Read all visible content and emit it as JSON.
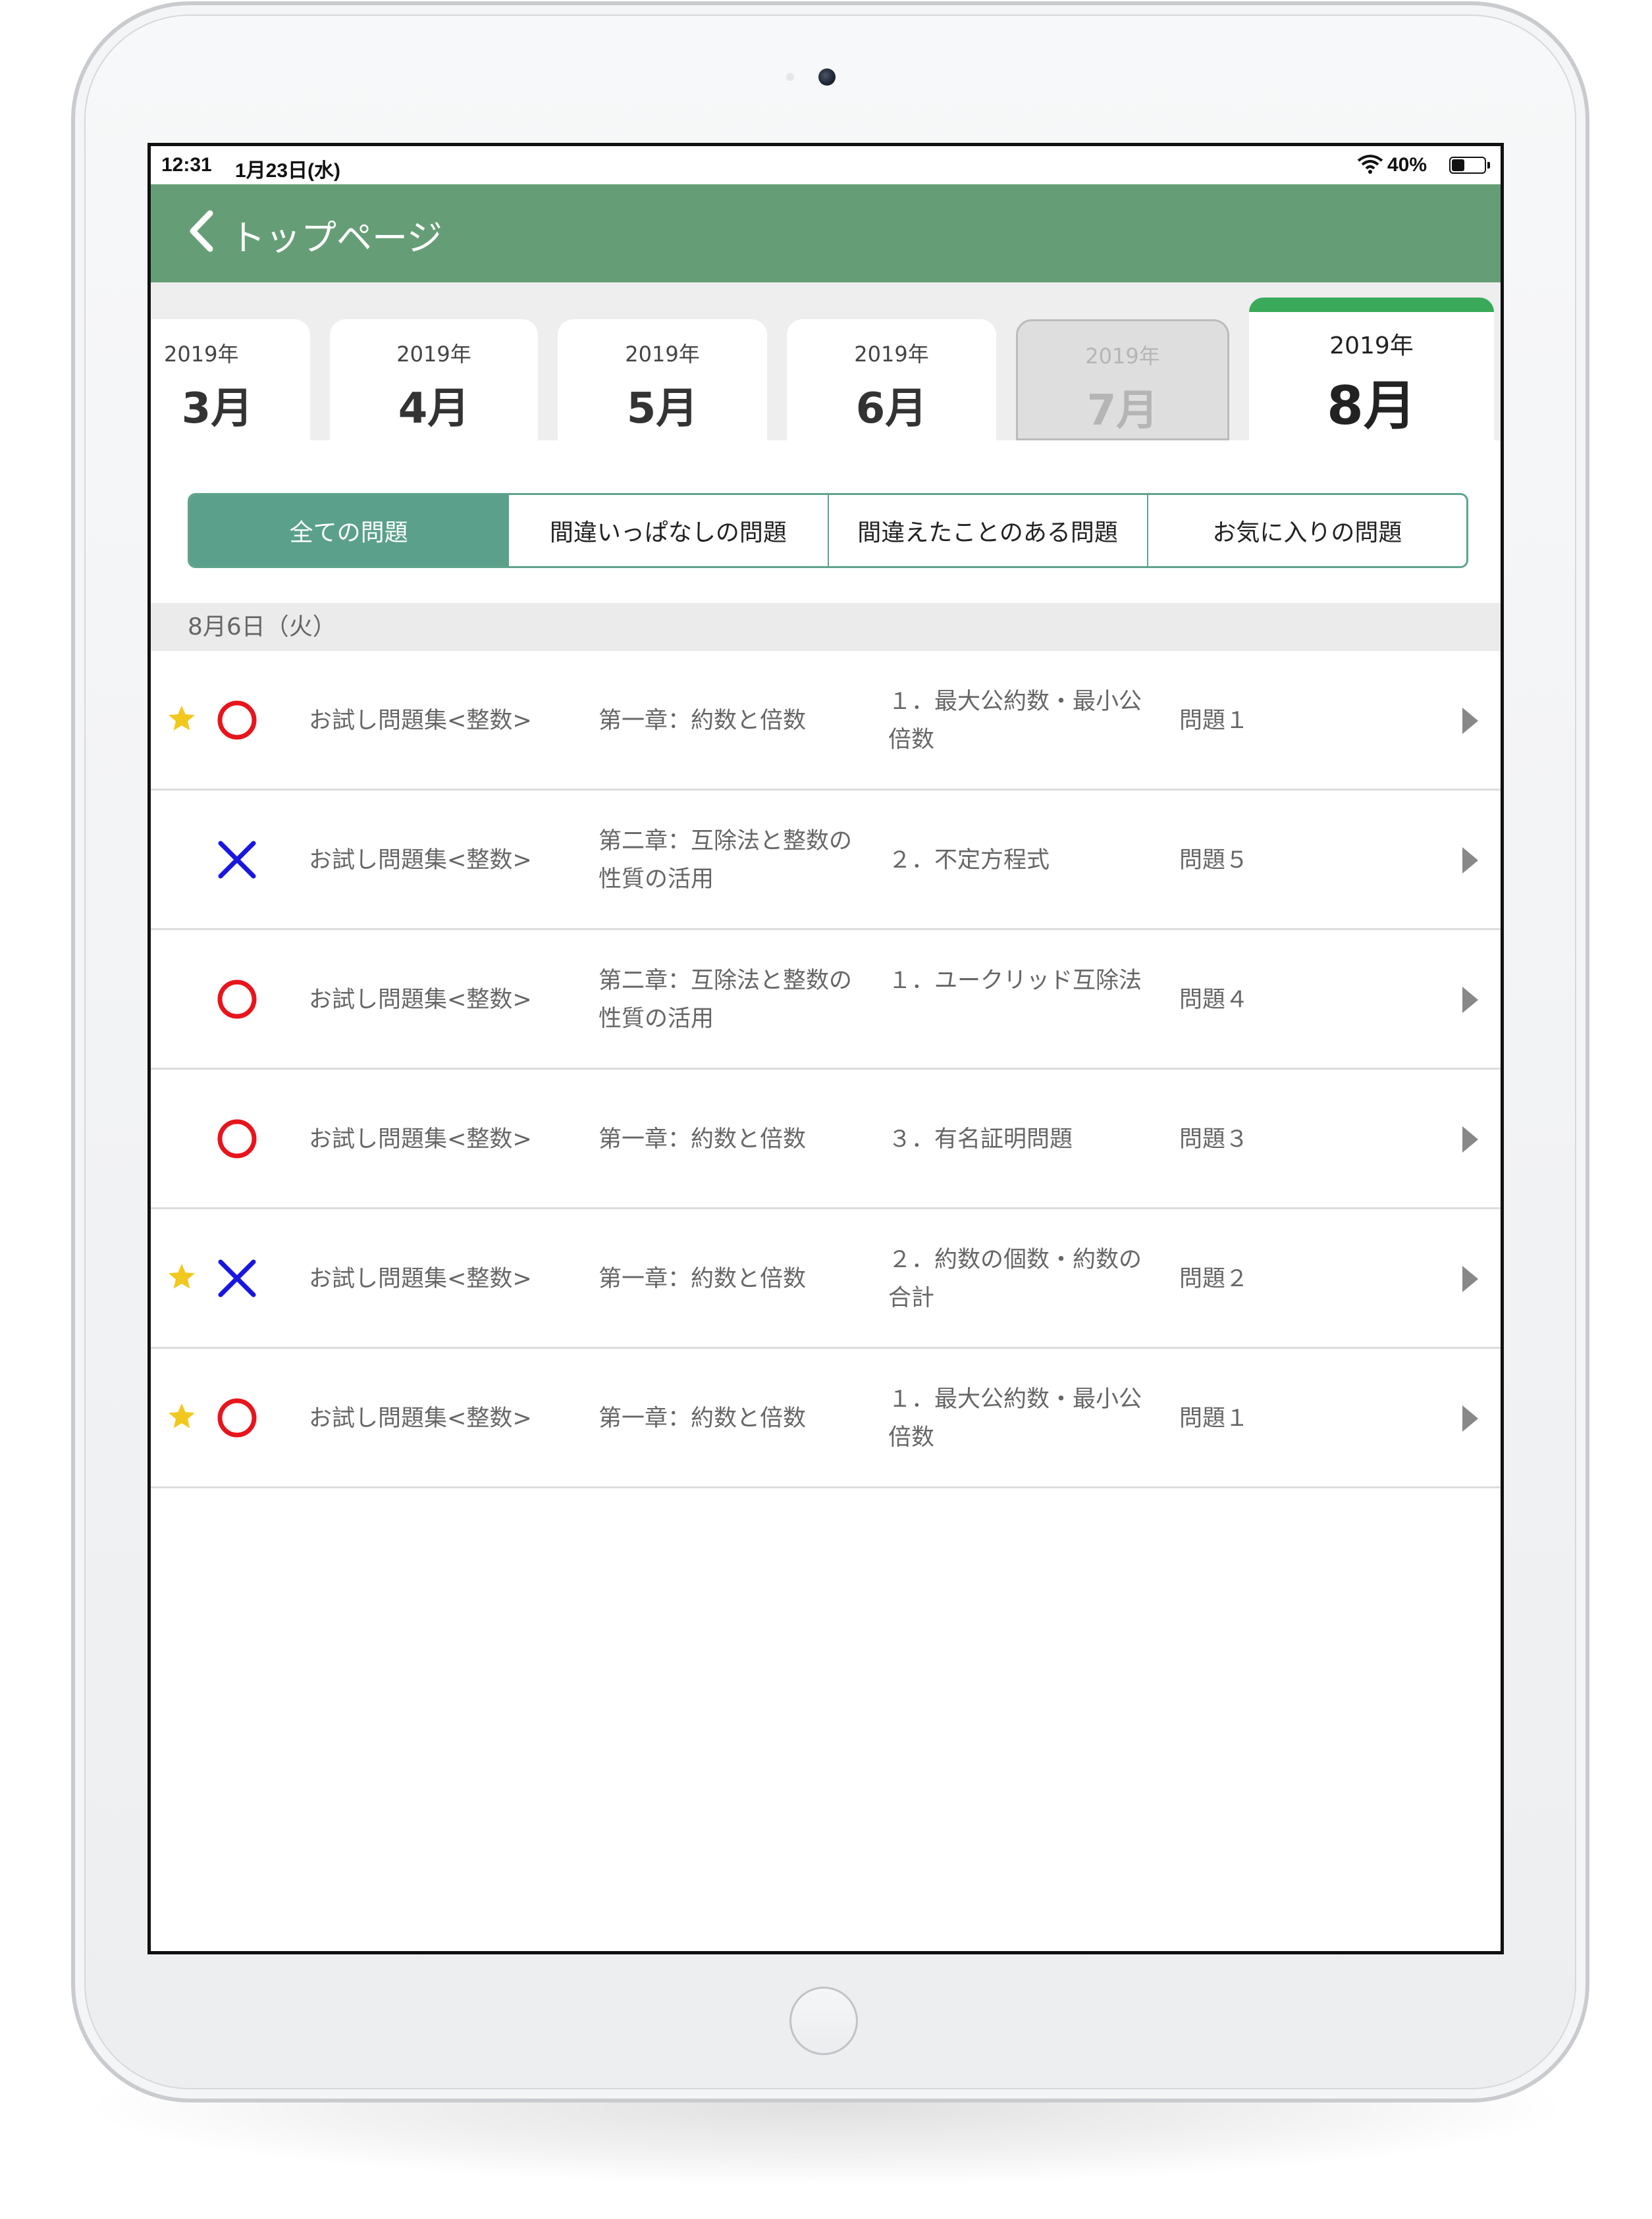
{
  "status_bar": {
    "time": "12:31",
    "date": "1月23日(水)",
    "battery": "40%"
  },
  "nav": {
    "back_label": "トップページ"
  },
  "months": [
    {
      "year": "2019年",
      "month": "3月",
      "state": "normal"
    },
    {
      "year": "2019年",
      "month": "4月",
      "state": "normal"
    },
    {
      "year": "2019年",
      "month": "5月",
      "state": "normal"
    },
    {
      "year": "2019年",
      "month": "6月",
      "state": "normal"
    },
    {
      "year": "2019年",
      "month": "7月",
      "state": "disabled"
    },
    {
      "year": "2019年",
      "month": "8月",
      "state": "active"
    }
  ],
  "filters": [
    {
      "label": "全ての問題",
      "active": true
    },
    {
      "label": "間違いっぱなしの問題",
      "active": false
    },
    {
      "label": "間違えたことのある問題",
      "active": false
    },
    {
      "label": "お気に入りの問題",
      "active": false
    }
  ],
  "section": {
    "date": "8月6日（火）"
  },
  "rows": [
    {
      "favorite": true,
      "result": "correct",
      "collection": "お試し問題集<整数>",
      "chapter": "第一章：約数と倍数",
      "section": "１．最大公約数・最小公倍数",
      "problem": "問題１"
    },
    {
      "favorite": false,
      "result": "incorrect",
      "collection": "お試し問題集<整数>",
      "chapter": "第二章：互除法と整数の性質の活用",
      "section": "２．不定方程式",
      "problem": "問題５"
    },
    {
      "favorite": false,
      "result": "correct",
      "collection": "お試し問題集<整数>",
      "chapter": "第二章：互除法と整数の性質の活用",
      "section": "１．ユークリッド互除法",
      "problem": "問題４"
    },
    {
      "favorite": false,
      "result": "correct",
      "collection": "お試し問題集<整数>",
      "chapter": "第一章：約数と倍数",
      "section": "３．有名証明問題",
      "problem": "問題３"
    },
    {
      "favorite": true,
      "result": "incorrect",
      "collection": "お試し問題集<整数>",
      "chapter": "第一章：約数と倍数",
      "section": "２．約数の個数・約数の合計",
      "problem": "問題２"
    },
    {
      "favorite": true,
      "result": "correct",
      "collection": "お試し問題集<整数>",
      "chapter": "第一章：約数と倍数",
      "section": "１．最大公約数・最小公倍数",
      "problem": "問題１"
    }
  ],
  "colors": {
    "nav_green": "#659e76",
    "active_tab_accent": "#3aaa5a",
    "segment_green": "#5aa08a",
    "correct_red": "#e8141c",
    "incorrect_blue": "#1a16e0",
    "star_yellow": "#f2c81e"
  },
  "icons": {
    "back": "chevron-left-icon",
    "favorite": "star-icon",
    "correct": "circle-icon",
    "incorrect": "cross-icon",
    "open": "play-arrow-icon",
    "wifi": "wifi-icon",
    "battery": "battery-icon"
  }
}
